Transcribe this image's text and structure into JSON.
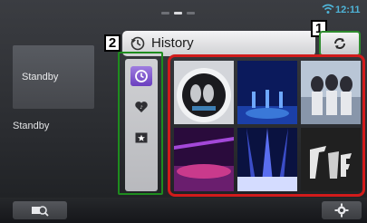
{
  "status": {
    "time": "12:11"
  },
  "source": {
    "tile_label": "Standby",
    "name": "Standby"
  },
  "header": {
    "title": "History"
  },
  "callouts": {
    "panel": "2",
    "refresh": "1"
  },
  "side_buttons": [
    {
      "icon": "history-clock-icon",
      "active": true
    },
    {
      "icon": "heart-icon",
      "active": false
    },
    {
      "icon": "star-icon",
      "active": false
    }
  ],
  "album_tiles": [
    {
      "icon": "album-art-thumbnail",
      "colors": [
        "#d7d9de",
        "#1a1a1e"
      ]
    },
    {
      "icon": "album-art-thumbnail",
      "colors": [
        "#0b1a5c",
        "#3a78d8"
      ]
    },
    {
      "icon": "album-art-thumbnail",
      "colors": [
        "#b9c6d6",
        "#5c6a7d"
      ]
    },
    {
      "icon": "album-art-thumbnail",
      "colors": [
        "#2a0b3c",
        "#c93a8c"
      ]
    },
    {
      "icon": "album-art-thumbnail",
      "colors": [
        "#0a1240",
        "#5a6ef0"
      ]
    },
    {
      "icon": "album-art-thumbnail",
      "colors": [
        "#202020",
        "#8a8a8a"
      ]
    }
  ],
  "colors": {
    "highlight_grid": "#d11b1b",
    "highlight_controls": "#1e8c1e",
    "clock": "#4fb4d8"
  }
}
